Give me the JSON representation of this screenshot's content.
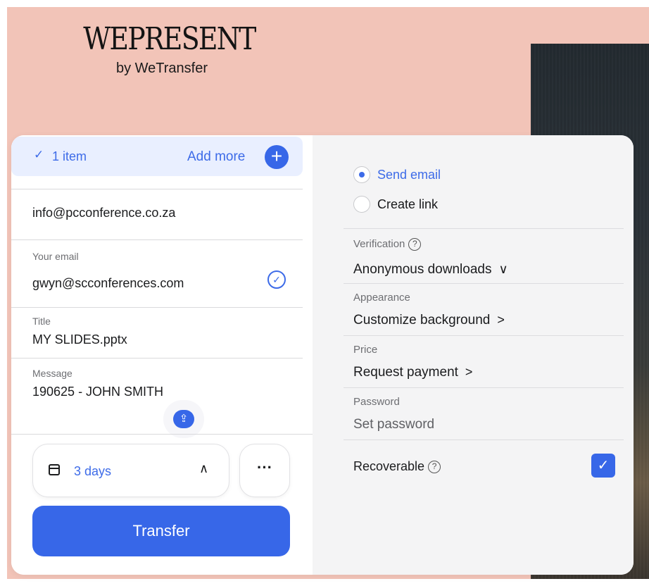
{
  "brand": {
    "logo_main": "WEPRESENT",
    "logo_sub": "by WeTransfer"
  },
  "items": {
    "count_label": "1 item",
    "add_more_label": "Add more"
  },
  "recipient": {
    "value": "info@pcconference.co.za"
  },
  "your_email": {
    "label": "Your email",
    "value": "gwyn@scconferences.com"
  },
  "title_field": {
    "label": "Title",
    "value": "MY SLIDES.pptx"
  },
  "message_field": {
    "label": "Message",
    "value": "190625 - JOHN SMITH"
  },
  "expiry": {
    "label": "3 days"
  },
  "more_label": "···",
  "transfer_label": "Transfer",
  "options": {
    "send_email": "Send email",
    "create_link": "Create link",
    "verification_label": "Verification",
    "verification_value": "Anonymous downloads",
    "appearance_label": "Appearance",
    "appearance_value": "Customize background",
    "price_label": "Price",
    "price_value": "Request payment",
    "password_label": "Password",
    "password_placeholder": "Set password",
    "recoverable_label": "Recoverable"
  },
  "colors": {
    "accent": "#3767e8",
    "background": "#f2c4b8",
    "panel": "#f4f4f5"
  }
}
